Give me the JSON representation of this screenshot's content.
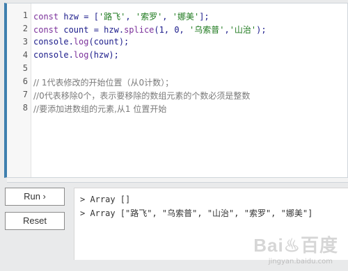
{
  "editor": {
    "line_numbers": [
      "1",
      "2",
      "3",
      "4",
      "5",
      "6",
      "7",
      "8"
    ],
    "lines": [
      {
        "parts": [
          {
            "t": "const ",
            "c": "kw"
          },
          {
            "t": "hzw = [",
            "c": "fn"
          },
          {
            "t": "'路飞'",
            "c": "str"
          },
          {
            "t": ", ",
            "c": "fn"
          },
          {
            "t": "'索罗'",
            "c": "str"
          },
          {
            "t": ", ",
            "c": "fn"
          },
          {
            "t": "'娜美'",
            "c": "str"
          },
          {
            "t": "];",
            "c": "fn"
          }
        ]
      },
      {
        "parts": [
          {
            "t": "const ",
            "c": "kw"
          },
          {
            "t": "count = hzw.",
            "c": "fn"
          },
          {
            "t": "splice",
            "c": "kw"
          },
          {
            "t": "(1, 0, ",
            "c": "fn"
          },
          {
            "t": "'乌索普'",
            "c": "str"
          },
          {
            "t": ",",
            "c": "fn"
          },
          {
            "t": "'山治'",
            "c": "str"
          },
          {
            "t": ");",
            "c": "fn"
          }
        ]
      },
      {
        "parts": [
          {
            "t": "console.",
            "c": "fn"
          },
          {
            "t": "log",
            "c": "kw"
          },
          {
            "t": "(count);",
            "c": "fn"
          }
        ]
      },
      {
        "parts": [
          {
            "t": "console.",
            "c": "fn"
          },
          {
            "t": "log",
            "c": "kw"
          },
          {
            "t": "(hzw);",
            "c": "fn"
          }
        ]
      },
      {
        "parts": []
      },
      {
        "parts": [
          {
            "t": "// 1代表修改的开始位置（从0计数）；",
            "c": "cmt"
          }
        ]
      },
      {
        "parts": [
          {
            "t": "//0代表移除0个，表示要移除的数组元素的个数必须是整数",
            "c": "cmt"
          }
        ]
      },
      {
        "parts": [
          {
            "t": "//要添加进数组的元素,从1 位置开始",
            "c": "cmt"
          }
        ]
      }
    ]
  },
  "buttons": {
    "run_label": "Run ›",
    "reset_label": "Reset"
  },
  "console": {
    "lines": [
      "> Array []",
      "> Array [\"路飞\", \"乌索普\", \"山治\", \"索罗\", \"娜美\"]"
    ]
  },
  "watermark": {
    "text": "Bai♨百度",
    "sub": "jingyan.baidu.com"
  },
  "colors": {
    "editor_accent": "#3e7fae",
    "keyword": "#7a2f9a",
    "string": "#1f7a1f",
    "comment": "#7a7a7a"
  }
}
